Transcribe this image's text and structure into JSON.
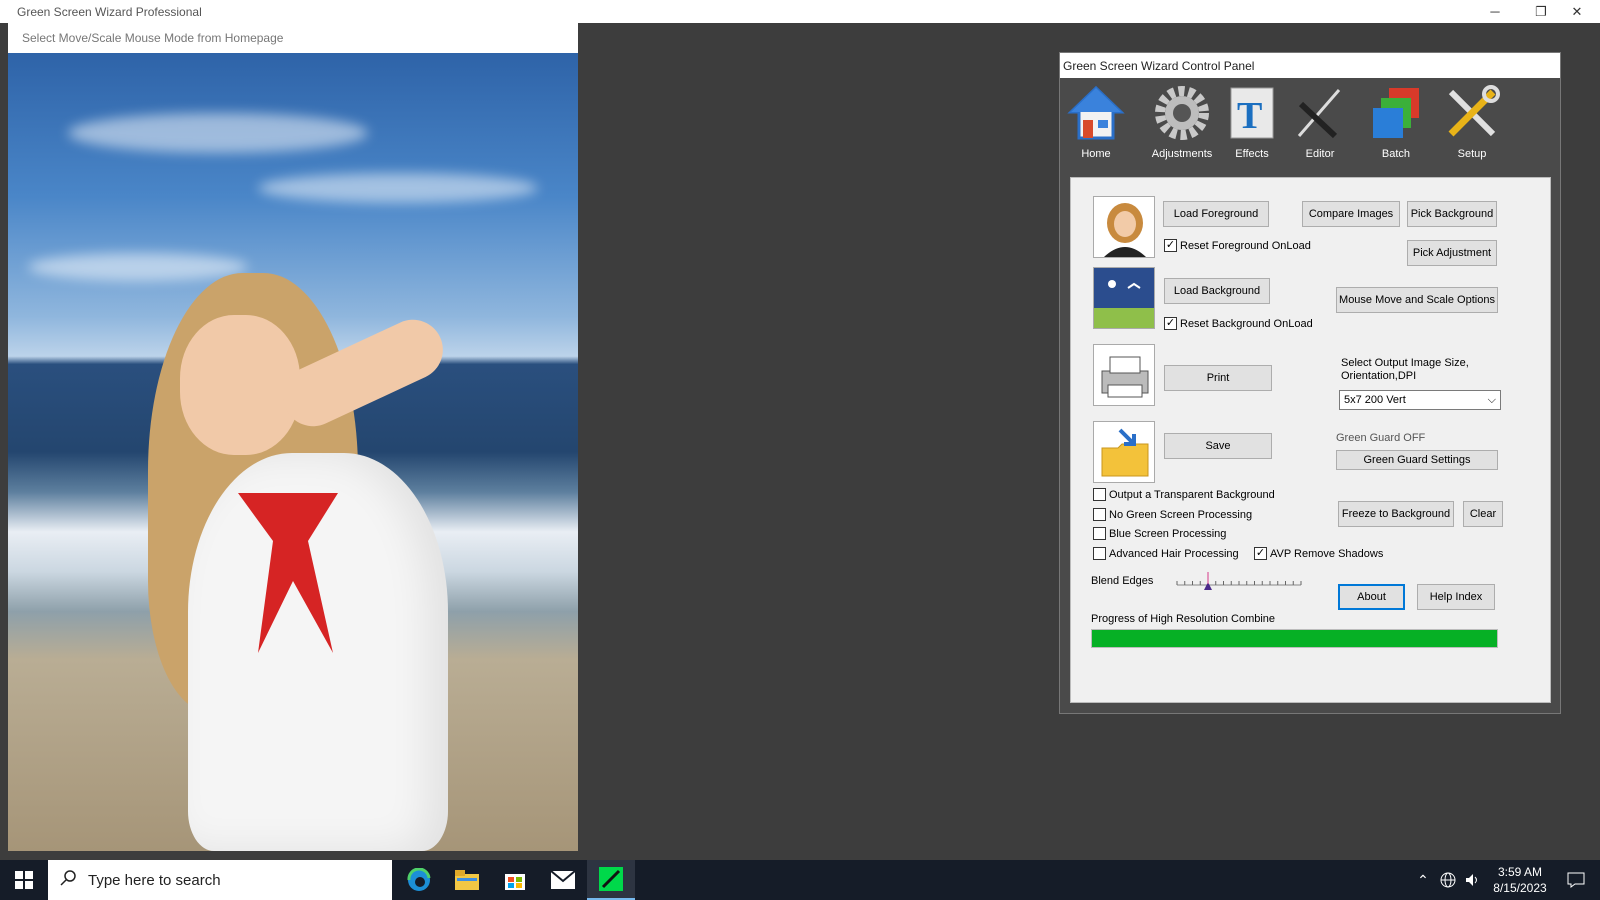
{
  "window": {
    "title": "Green Screen Wizard Professional",
    "minimize": "─",
    "restore": "❐",
    "close": "✕"
  },
  "preview": {
    "hint": "Select Move/Scale Mouse Mode from Homepage"
  },
  "panel": {
    "title": "Green Screen Wizard Control Panel",
    "toolbar": [
      {
        "label": "Home",
        "icon": "home-icon"
      },
      {
        "label": "Adjustments",
        "icon": "gear-icon"
      },
      {
        "label": "Effects",
        "icon": "effects-icon"
      },
      {
        "label": "Editor",
        "icon": "editor-icon"
      },
      {
        "label": "Batch",
        "icon": "batch-icon"
      },
      {
        "label": "Setup",
        "icon": "setup-icon"
      }
    ],
    "buttons": {
      "load_foreground": "Load Foreground",
      "compare_images": "Compare Images",
      "pick_background": "Pick Background",
      "pick_adjustment": "Pick Adjustment",
      "load_background": "Load Background",
      "mouse_move_scale": "Mouse Move and Scale Options",
      "print": "Print",
      "save": "Save",
      "green_guard_settings": "Green Guard Settings",
      "freeze_to_background": "Freeze to Background",
      "clear": "Clear",
      "about": "About",
      "help_index": "Help Index"
    },
    "checkboxes": {
      "reset_foreground": {
        "label": "Reset Foreground OnLoad",
        "checked": true
      },
      "reset_background": {
        "label": "Reset Background OnLoad",
        "checked": true
      },
      "transparent_bg": {
        "label": "Output a Transparent Background",
        "checked": false
      },
      "no_green_screen": {
        "label": "No Green Screen Processing",
        "checked": false
      },
      "blue_screen": {
        "label": "Blue Screen Processing",
        "checked": false
      },
      "advanced_hair": {
        "label": "Advanced Hair Processing",
        "checked": false
      },
      "avp_remove_shadows": {
        "label": "AVP Remove Shadows",
        "checked": true
      }
    },
    "output_size_label": "Select Output Image Size, Orientation,DPI",
    "output_size_value": "5x7 200 Vert",
    "green_guard_status": "Green Guard OFF",
    "blend_edges_label": "Blend Edges",
    "blend_edges_value": 4,
    "blend_edges_max": 16,
    "progress_label": "Progress of High Resolution Combine",
    "progress_value": 1.0,
    "colors": {
      "progress": "#06b025",
      "accent": "#0078d7"
    }
  },
  "taskbar": {
    "search_placeholder": "Type here to search",
    "time": "3:59 AM",
    "date": "8/15/2023"
  }
}
